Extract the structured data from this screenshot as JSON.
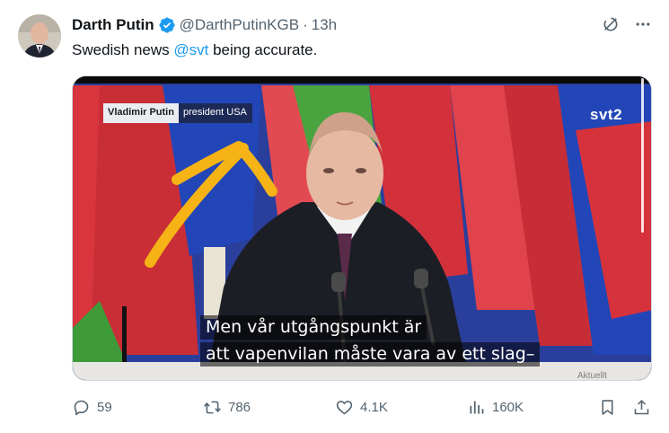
{
  "author": {
    "display_name": "Darth Putin",
    "handle": "@DarthPutinKGB",
    "separator": "·",
    "time": "13h"
  },
  "tweet": {
    "text_before": "Swedish news ",
    "mention": "@svt",
    "text_after": " being accurate."
  },
  "media": {
    "lower_third_name": "Vladimir Putin",
    "lower_third_title": "president USA",
    "channel_logo": "svt2",
    "subtitle_line1": "Men vår utgångspunkt är",
    "subtitle_line2": "att vapenvilan måste vara av ett slag–",
    "watermark": "Aktuellt"
  },
  "actions": {
    "replies": "59",
    "reposts": "786",
    "likes": "4.1K",
    "views": "160K"
  },
  "icons": {
    "top": [
      "grok-icon",
      "more-icon"
    ],
    "actions": [
      "reply-icon",
      "repost-icon",
      "like-icon",
      "views-icon",
      "bookmark-icon",
      "share-icon"
    ]
  },
  "colors": {
    "accent": "#1d9bf0",
    "secondary_text": "#536471",
    "arrow": "#f5b316"
  }
}
